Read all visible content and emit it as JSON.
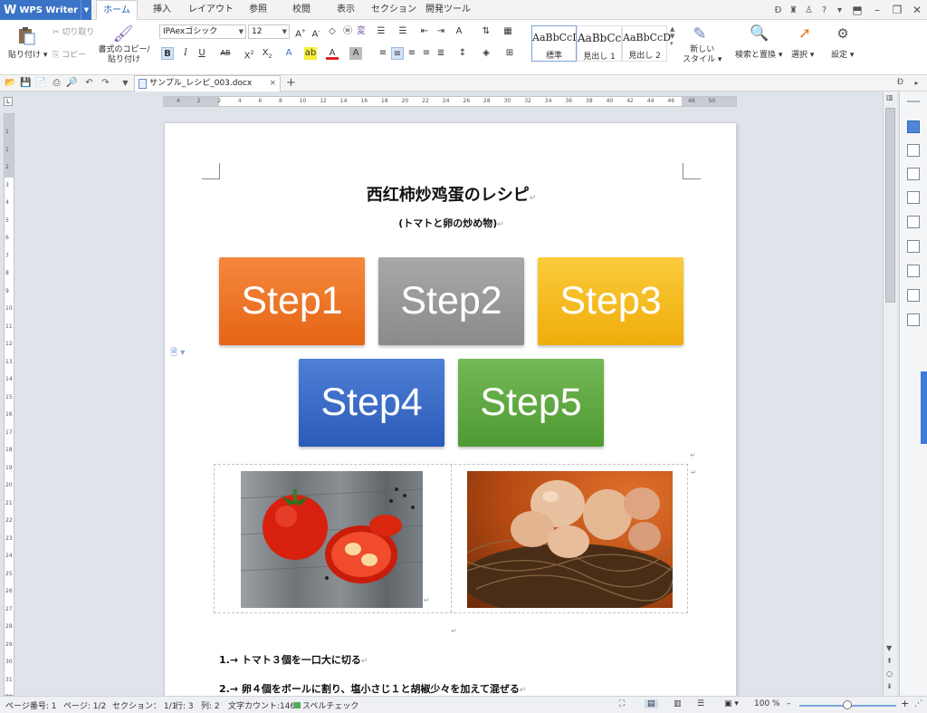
{
  "app": {
    "name": "WPS Writer"
  },
  "menu": {
    "tabs": [
      "ホーム",
      "挿入",
      "レイアウト",
      "参照",
      "校閲",
      "表示",
      "セクション",
      "開発ツール"
    ],
    "active_tab": "ホーム"
  },
  "ribbon": {
    "paste": "貼り付け",
    "cut": "切り取り",
    "copy": "コピー",
    "format_painter_line1": "書式のコピー/",
    "format_painter_line2": "貼り付け",
    "font_name": "IPAexゴシック",
    "font_size": "12",
    "styles": [
      {
        "sample": "AaBbCcI",
        "name": "標準"
      },
      {
        "sample": "AaBbCc",
        "name": "見出し 1"
      },
      {
        "sample": "AaBbCcD",
        "name": "見出し 2"
      }
    ],
    "new_style_line1": "新しい",
    "new_style_line2": "スタイル",
    "find_replace": "検索と置換",
    "select": "選択",
    "settings": "設定"
  },
  "document_tab": {
    "name": "サンプル_レシピ_003.docx"
  },
  "ruler": {
    "h_ticks": [
      "4",
      "2",
      "2",
      "4",
      "6",
      "8",
      "10",
      "12",
      "14",
      "16",
      "18",
      "20",
      "22",
      "24",
      "26",
      "28",
      "30",
      "32",
      "34",
      "36",
      "38",
      "40",
      "42",
      "44",
      "46",
      "48",
      "50"
    ],
    "v_ticks": [
      "1",
      "1",
      "2",
      "3",
      "4",
      "5",
      "6",
      "7",
      "8",
      "9",
      "10",
      "11",
      "12",
      "13",
      "14",
      "15",
      "16",
      "17",
      "18",
      "19",
      "20",
      "21",
      "22",
      "23",
      "24",
      "25",
      "26",
      "27",
      "28",
      "29",
      "30",
      "31",
      "32"
    ]
  },
  "document": {
    "title": "西红柿炒鸡蛋のレシピ",
    "subtitle": "(トマトと卵の炒め物)",
    "steps": [
      "Step1",
      "Step2",
      "Step3",
      "Step4",
      "Step5"
    ],
    "instructions": [
      "1.→ トマト３個を一口大に切る",
      "2.→ 卵４個をボールに割り、塩小さじ１と胡椒少々を加えて混ぜる"
    ],
    "paragraph_mark": "↵"
  },
  "status": {
    "page_no": "ページ番号: 1",
    "pages": "ページ: 1/2",
    "section": "セクション： 1/1",
    "row": "行: 3",
    "col": "列: 2",
    "word_count": "文字カウント:146",
    "spell_check": "スペルチェック",
    "zoom": "100 %"
  },
  "colors": {
    "step1": "#ef7a2a",
    "step2": "#9a9a9a",
    "step3": "#f5bb1f",
    "step4": "#3e6fcb",
    "step5": "#62a843",
    "accent": "#3b73c6"
  }
}
